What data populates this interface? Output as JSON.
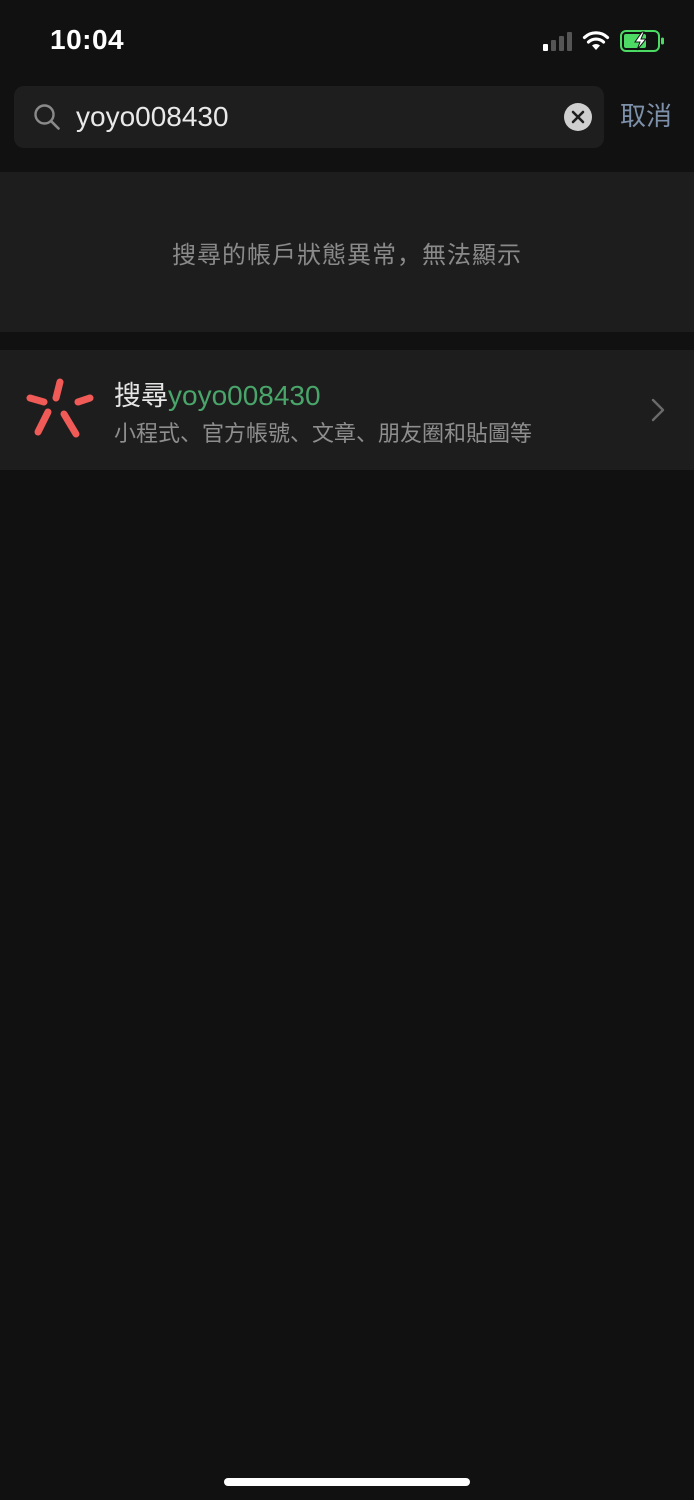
{
  "status_bar": {
    "time": "10:04"
  },
  "search": {
    "query": "yoyo008430",
    "cancel_label": "取消"
  },
  "notice": {
    "text": "搜尋的帳戶狀態異常，無法顯示"
  },
  "search_online": {
    "prefix": "搜尋",
    "query": "yoyo008430",
    "subtitle": "小程式、官方帳號、文章、朋友圈和貼圖等"
  },
  "colors": {
    "background": "#111111",
    "accent_link": "#7d90a9",
    "highlight_green": "#4aa56a",
    "logo_red": "#f05a57",
    "battery_green": "#4cd964"
  },
  "icons": {
    "search": "search-icon",
    "clear": "clear-icon",
    "chevron": "chevron-right-icon",
    "logo": "search-discover-logo-icon",
    "signal": "cellular-signal-icon",
    "wifi": "wifi-icon",
    "battery": "battery-charging-icon"
  }
}
